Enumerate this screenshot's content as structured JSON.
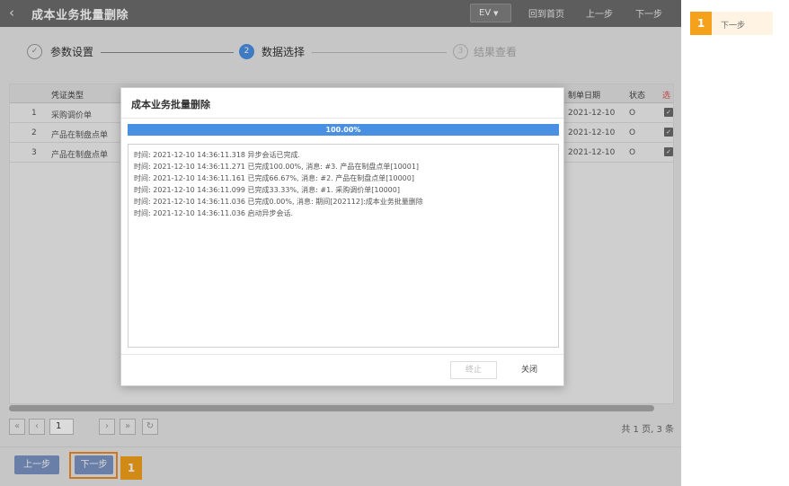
{
  "titlebar": {
    "title": "成本业务批量删除",
    "ev_label": "EV",
    "home_label": "回到首页",
    "prev_label": "上一步",
    "next_label": "下一步"
  },
  "steps": [
    {
      "num": "✓",
      "label": "参数设置"
    },
    {
      "num": "2",
      "label": "数据选择"
    },
    {
      "num": "3",
      "label": "结果查看"
    }
  ],
  "table": {
    "headers": {
      "type": "凭证类型",
      "date": "制单日期",
      "status": "状态",
      "select": "选"
    },
    "rows": [
      {
        "index": "1",
        "type": "采购调价单",
        "date": "2021-12-10",
        "status": "O"
      },
      {
        "index": "2",
        "type": "产品在制盘点单",
        "date": "2021-12-10",
        "status": "O"
      },
      {
        "index": "3",
        "type": "产品在制盘点单",
        "date": "2021-12-10",
        "status": "O"
      }
    ]
  },
  "pager": {
    "first": "«",
    "prev": "‹",
    "page": "1",
    "next": "›",
    "last": "»",
    "total": "共 1 页, 3 条"
  },
  "footer": {
    "prev_label": "上一步",
    "next_label": "下一步",
    "badge": "1"
  },
  "modal": {
    "title": "成本业务批量删除",
    "progress": {
      "text": "100.00%",
      "value": 100
    },
    "log": [
      "时间: 2021-12-10 14:36:11.318 异步会话已完成.",
      "时间: 2021-12-10 14:36:11.271 已完成100.00%, 消息: #3. 产品在制盘点单[10001]",
      "时间: 2021-12-10 14:36:11.161 已完成66.67%, 消息: #2. 产品在制盘点单[10000]",
      "时间: 2021-12-10 14:36:11.099 已完成33.33%, 消息: #1. 采购调价单[10000]",
      "时间: 2021-12-10 14:36:11.036 已完成0.00%, 消息: 期间[202112]:成本业务批量删除",
      "时间: 2021-12-10 14:36:11.036 启动异步会话."
    ],
    "stop_label": "终止",
    "close_label": "关闭"
  },
  "right_panel": {
    "badge": "1",
    "text": "下一步"
  },
  "colors": {
    "accent": "#4a90e2",
    "highlight": "#f28a25",
    "badge": "#f5a11b",
    "button": "#7c94c4"
  }
}
